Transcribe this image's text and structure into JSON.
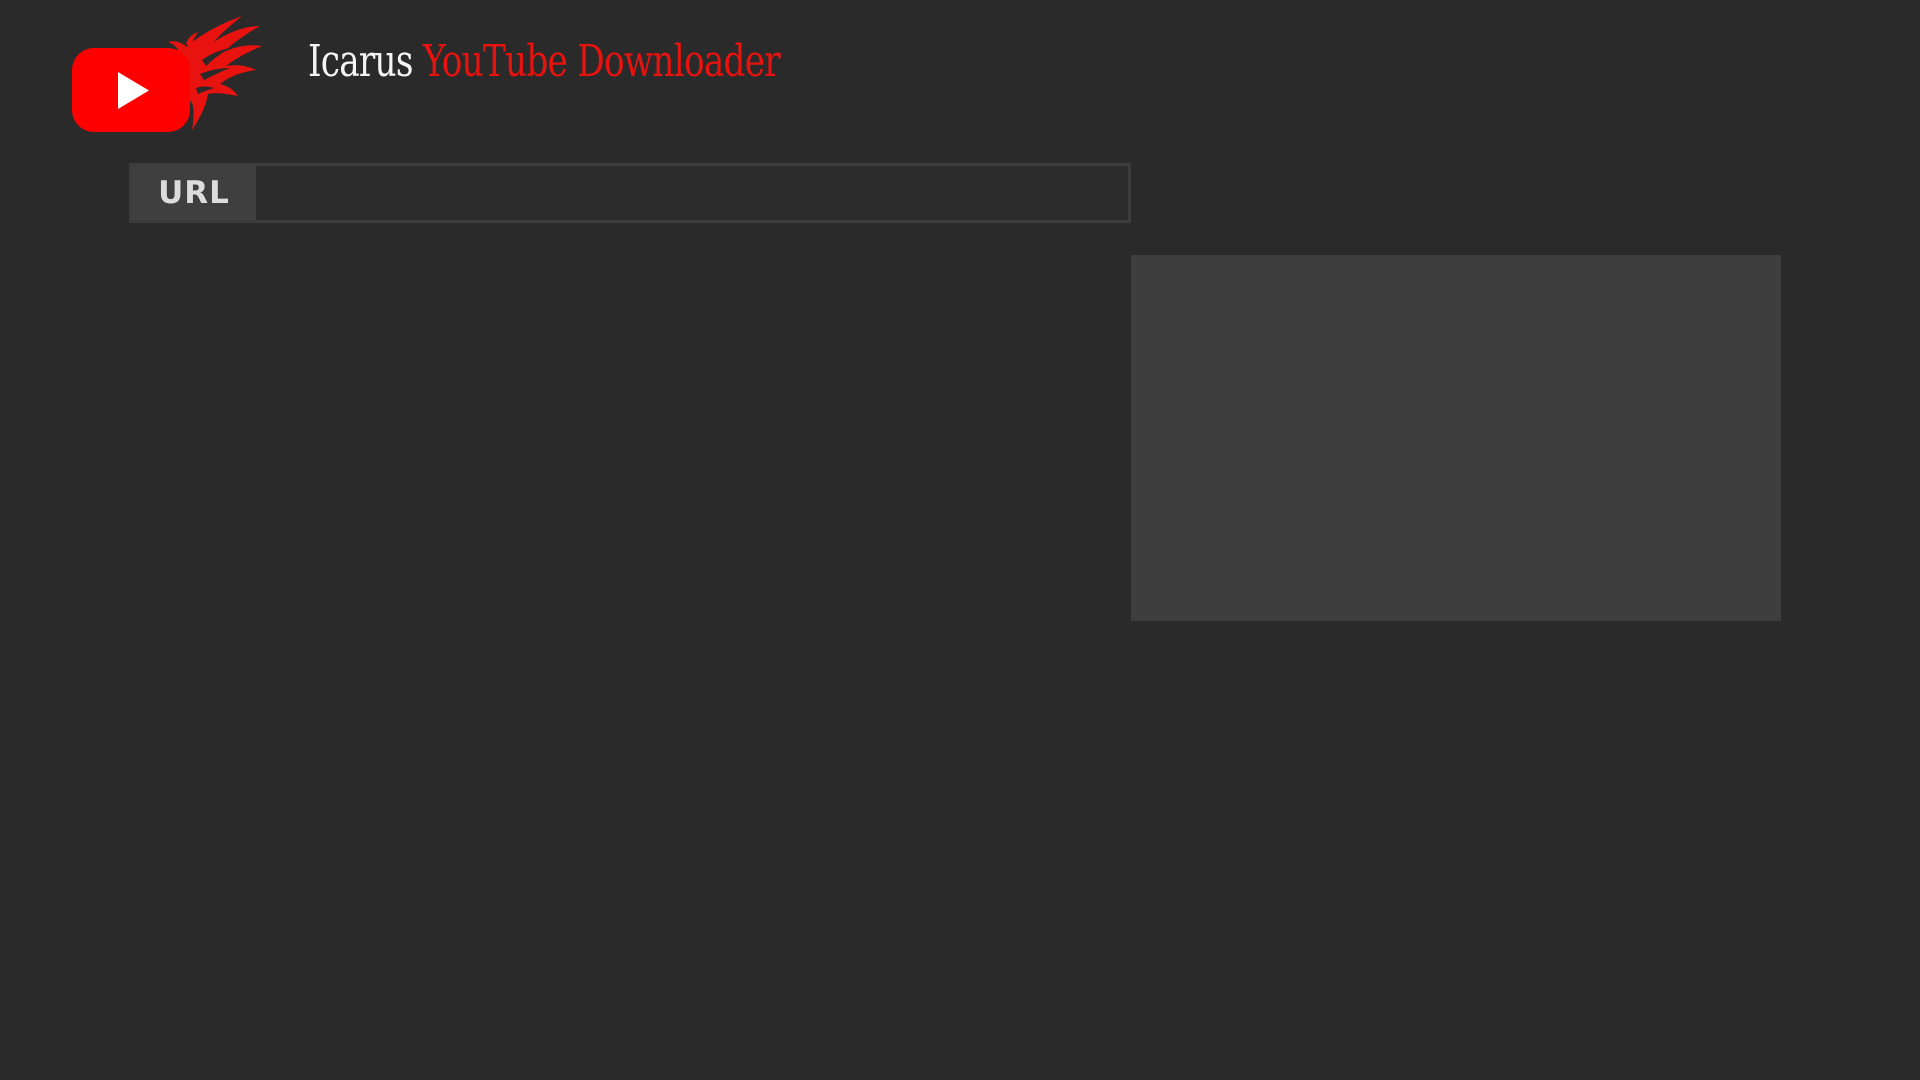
{
  "header": {
    "title_part1": "Icarus",
    "title_part2": "YouTube Downloader",
    "logo_icon": "youtube-phoenix-logo-icon"
  },
  "url_bar": {
    "label": "URL",
    "value": "",
    "placeholder": ""
  },
  "colors": {
    "background": "#2a2a2a",
    "brand_red": "#e8120e",
    "panel": "#3e3e3e"
  }
}
